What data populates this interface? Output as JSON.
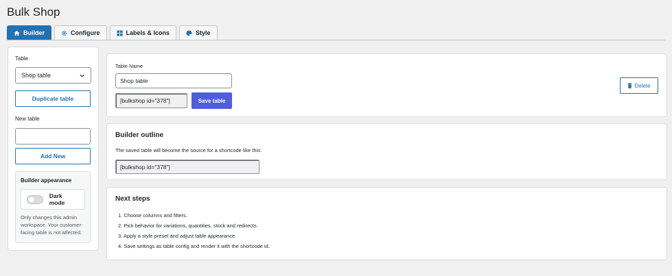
{
  "page": {
    "title": "Bulk Shop"
  },
  "tabs": [
    {
      "label": "Builder",
      "icon": "home-icon",
      "active": true
    },
    {
      "label": "Configure",
      "icon": "gear-icon",
      "active": false
    },
    {
      "label": "Labels & Icons",
      "icon": "grid-icon",
      "active": false
    },
    {
      "label": "Style",
      "icon": "palette-icon",
      "active": false
    }
  ],
  "sidebar": {
    "table_label": "Table",
    "table_select_value": "Shop table",
    "duplicate_label": "Duplicate table",
    "new_table_label": "New table",
    "new_table_value": "",
    "add_new_label": "Add New",
    "appearance": {
      "title": "Builder appearance",
      "toggle_label": "Dark mode",
      "toggle_on": false,
      "note": "Only changes this admin workspace. Your customer-facing table is not affected."
    }
  },
  "table_card": {
    "name_label": "Table Name",
    "name_value": "Shop table",
    "shortcode": "[bulkshop id=\"378\"]",
    "save_label": "Save table",
    "delete_label": "Delete"
  },
  "outline_card": {
    "title": "Builder outline",
    "description": "The saved table will become the source for a shortcode like this:",
    "shortcode": "[bulkshop id=\"378\"]"
  },
  "next_steps": {
    "title": "Next steps",
    "items": [
      "1. Choose columns and filters.",
      "2. Pick behavior for variations, quantities, stock and redirects.",
      "3. Apply a style preset and adjust table appearance.",
      "4. Save settings as table config and render it with the shortcode id."
    ]
  },
  "colors": {
    "accent": "#2271b1",
    "primary_button": "#4f5ddf",
    "background": "#f0f0f1"
  }
}
